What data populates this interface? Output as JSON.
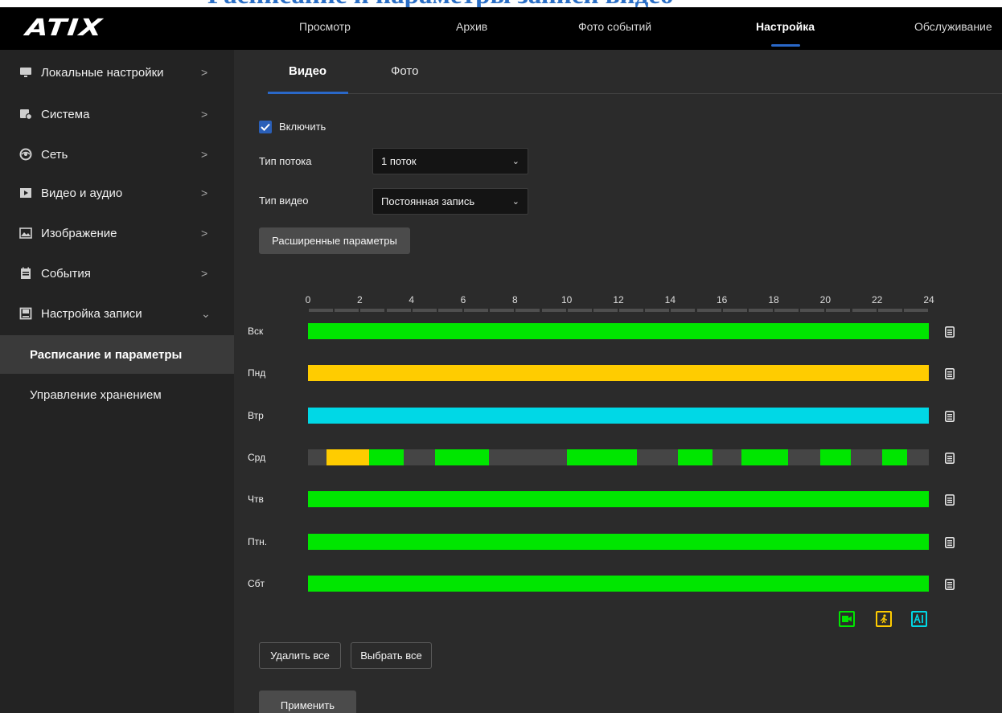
{
  "heading": "Расписание и параметры записи видео",
  "brand": "ATIX",
  "nav": [
    {
      "label": "Просмотр"
    },
    {
      "label": "Архив"
    },
    {
      "label": "Фото событий"
    },
    {
      "label": "Настройка"
    },
    {
      "label": "Обслуживание"
    }
  ],
  "sidebar": {
    "items": [
      {
        "label": "Локальные настройки",
        "icon": "monitor-icon",
        "chevron": ">"
      },
      {
        "label": "Система",
        "icon": "system-icon",
        "chevron": ">"
      },
      {
        "label": "Сеть",
        "icon": "network-icon",
        "chevron": ">"
      },
      {
        "label": "Видео и аудио",
        "icon": "video-audio-icon",
        "chevron": ">"
      },
      {
        "label": "Изображение",
        "icon": "image-icon",
        "chevron": ">"
      },
      {
        "label": "События",
        "icon": "events-icon",
        "chevron": ">"
      },
      {
        "label": "Настройка записи",
        "icon": "record-settings-icon",
        "chevron": "⌄"
      }
    ],
    "subitems": [
      {
        "label": "Расписание и параметры"
      },
      {
        "label": "Управление хранением"
      }
    ]
  },
  "tabs": [
    {
      "label": "Видео"
    },
    {
      "label": "Фото"
    }
  ],
  "form": {
    "enable_label": "Включить",
    "enabled": true,
    "stream_type_label": "Тип потока",
    "stream_type_value": "1 поток",
    "video_type_label": "Тип видео",
    "video_type_value": "Постоянная запись",
    "advanced_button": "Расширенные параметры"
  },
  "schedule": {
    "hours": [
      "0",
      "2",
      "4",
      "6",
      "8",
      "10",
      "12",
      "14",
      "16",
      "18",
      "20",
      "22",
      "24"
    ],
    "colors": {
      "continuous": "#00e600",
      "motion": "#ffcc00",
      "ai": "#00d8e6",
      "empty": "#454545"
    },
    "days": [
      {
        "label": "Вск",
        "segments": [
          {
            "start": 0,
            "end": 24,
            "type": "continuous"
          }
        ]
      },
      {
        "label": "Пнд",
        "segments": [
          {
            "start": 0,
            "end": 24,
            "type": "motion"
          }
        ]
      },
      {
        "label": "Втр",
        "segments": [
          {
            "start": 0,
            "end": 24,
            "type": "ai"
          }
        ]
      },
      {
        "label": "Срд",
        "segments": [
          {
            "start": 0.7,
            "end": 2.35,
            "type": "motion"
          },
          {
            "start": 2.35,
            "end": 3.7,
            "type": "continuous"
          },
          {
            "start": 4.9,
            "end": 7.0,
            "type": "continuous"
          },
          {
            "start": 10.0,
            "end": 12.7,
            "type": "continuous"
          },
          {
            "start": 14.3,
            "end": 15.65,
            "type": "continuous"
          },
          {
            "start": 16.75,
            "end": 18.55,
            "type": "continuous"
          },
          {
            "start": 19.8,
            "end": 21.0,
            "type": "continuous"
          },
          {
            "start": 22.2,
            "end": 23.15,
            "type": "continuous"
          }
        ]
      },
      {
        "label": "Чтв",
        "segments": [
          {
            "start": 0,
            "end": 24,
            "type": "continuous"
          }
        ]
      },
      {
        "label": "Птн.",
        "segments": [
          {
            "start": 0,
            "end": 24,
            "type": "continuous"
          }
        ]
      },
      {
        "label": "Сбт",
        "segments": [
          {
            "start": 0,
            "end": 24,
            "type": "continuous"
          }
        ]
      }
    ],
    "legend": [
      {
        "icon": "continuous-record-icon",
        "color": "#00e600"
      },
      {
        "icon": "motion-record-icon",
        "color": "#ffcc00"
      },
      {
        "icon": "ai-record-icon",
        "color": "#00d8e6"
      }
    ]
  },
  "buttons": {
    "delete_all": "Удалить все",
    "select_all": "Выбрать все",
    "apply": "Применить"
  }
}
